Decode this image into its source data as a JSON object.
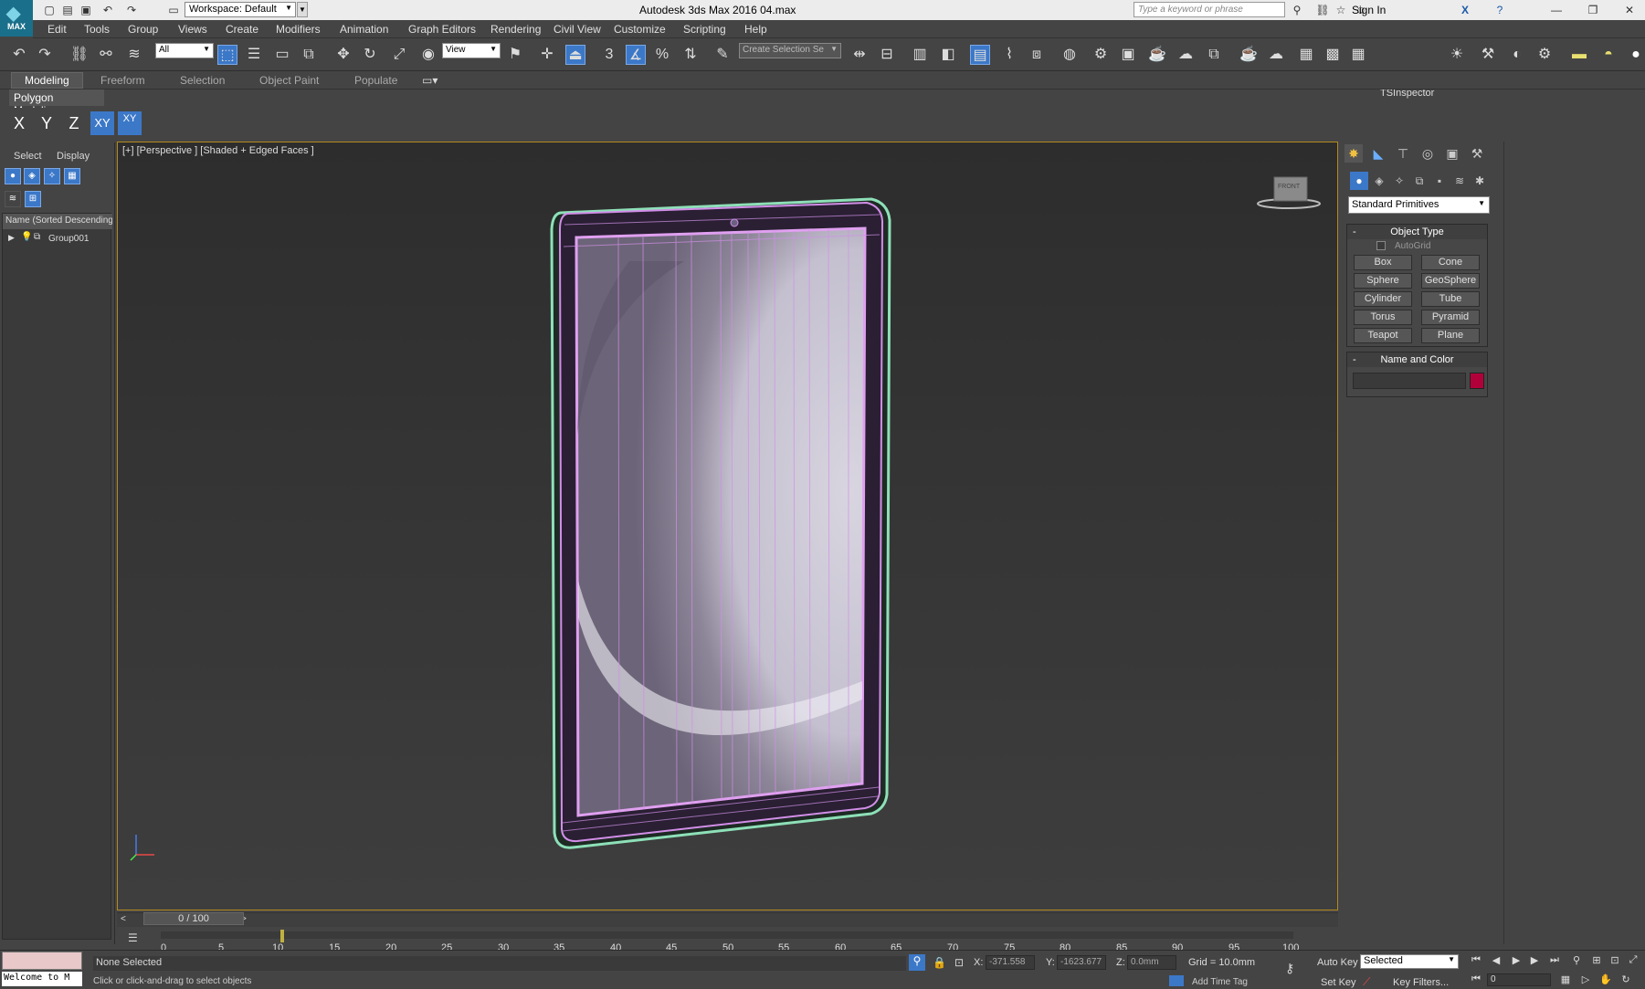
{
  "window": {
    "title": "Autodesk 3ds Max 2016      04.max"
  },
  "app_logo": "MAX",
  "workspace": {
    "label": "Workspace: Default"
  },
  "infocenter": {
    "search_placeholder": "Type a keyword or phrase",
    "sign_in": "Sign In"
  },
  "menu": [
    "Edit",
    "Tools",
    "Group",
    "Views",
    "Create",
    "Modifiers",
    "Animation",
    "Graph Editors",
    "Rendering",
    "Civil View",
    "Customize",
    "Scripting",
    "Help"
  ],
  "toolbar": {
    "selection_filter": "All",
    "ref_coord": "View",
    "named_selection": "Create Selection Se",
    "tsinspector": "TSInspector",
    "snaps": "3",
    "snap_angle": "%"
  },
  "ribbon": {
    "tabs": [
      "Modeling",
      "Freeform",
      "Selection",
      "Object Paint",
      "Populate"
    ],
    "active": "Modeling",
    "panel": "Polygon Modeling"
  },
  "axis_constraints": [
    "X",
    "Y",
    "Z",
    "XY",
    "XY"
  ],
  "scene_explorer": {
    "tabs": [
      "Select",
      "Display"
    ],
    "column_header": "Name (Sorted Descending",
    "items": [
      "Group001"
    ]
  },
  "viewport": {
    "label": "[+] [Perspective ] [Shaded + Edged Faces ]",
    "viewcube_label": "FRONT"
  },
  "command_panel": {
    "category": "Standard Primitives",
    "object_type": {
      "title": "Object Type",
      "autogrid": "AutoGrid",
      "buttons": [
        "Box",
        "Cone",
        "Sphere",
        "GeoSphere",
        "Cylinder",
        "Tube",
        "Torus",
        "Pyramid",
        "Teapot",
        "Plane"
      ]
    },
    "name_color": {
      "title": "Name and Color",
      "color": "#b2003a"
    }
  },
  "timeline": {
    "position": "0 / 100",
    "ticks": [
      "0",
      "5",
      "10",
      "15",
      "20",
      "25",
      "30",
      "35",
      "40",
      "45",
      "50",
      "55",
      "60",
      "65",
      "70",
      "75",
      "80",
      "85",
      "90",
      "95",
      "100"
    ]
  },
  "status": {
    "listener": "Welcome to M",
    "selection": "None Selected",
    "prompt": "Click or click-and-drag to select objects",
    "x_label": "X:",
    "x": "-371.558",
    "y_label": "Y:",
    "y": "-1623.677",
    "z_label": "Z:",
    "z": "0.0mm",
    "grid": "Grid = 10.0mm",
    "add_time_tag": "Add Time Tag",
    "auto_key": "Auto Key",
    "set_key": "Set Key",
    "key_mode": "Selected",
    "key_filters": "Key Filters...",
    "current_frame": "0"
  }
}
